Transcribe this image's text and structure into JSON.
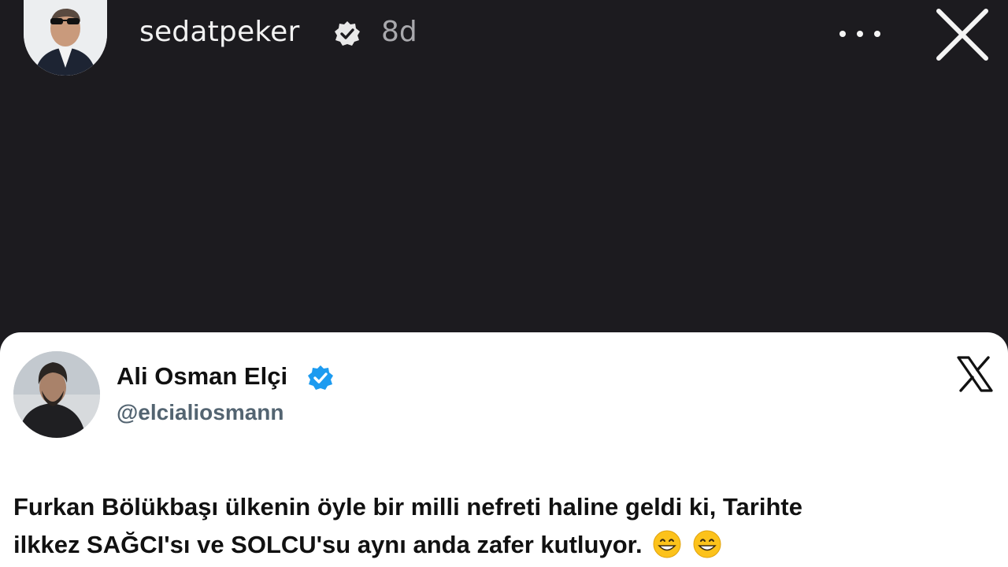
{
  "story": {
    "username": "sedatpeker",
    "time_ago": "8d",
    "icons": {
      "verified": "verified-badge-icon",
      "more": "more-options-icon",
      "close": "close-icon"
    }
  },
  "tweet": {
    "display_name": "Ali Osman Elçi",
    "handle": "@elcialiosmann",
    "text_line1": "Furkan Bölükbaşı ülkenin öyle bir milli nefreti haline geldi ki, Tarihte",
    "text_line2": "ilkkez SAĞCI'sı ve SOLCU'su aynı anda zafer kutluyor.",
    "emoji_count": 2,
    "verified_color": "#1d9bf0"
  },
  "colors": {
    "background": "#1c1b1f",
    "card": "#ffffff",
    "handle": "#536471"
  }
}
